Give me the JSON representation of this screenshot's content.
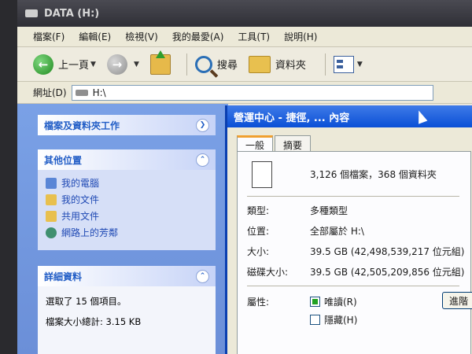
{
  "window": {
    "title": "DATA (H:)"
  },
  "menu": [
    "檔案(F)",
    "編輯(E)",
    "檢視(V)",
    "我的最愛(A)",
    "工具(T)",
    "說明(H)"
  ],
  "toolbar": {
    "back": "上一頁",
    "search": "搜尋",
    "folders": "資料夾"
  },
  "address": {
    "label": "網址(D)",
    "value": "H:\\"
  },
  "tasks": {
    "file_folder_tasks": "檔案及資料夾工作",
    "other_places": {
      "title": "其他位置",
      "items": [
        "我的電腦",
        "我的文件",
        "共用文件",
        "網路上的芳鄰"
      ]
    },
    "details": {
      "title": "詳細資料",
      "selected": "選取了 15 個項目。",
      "total_size": "檔案大小總計: 3.15 KB"
    }
  },
  "dialog": {
    "title": "營運中心 - 捷徑, ... 內容",
    "tabs": [
      "一般",
      "摘要"
    ],
    "summary": "3,126 個檔案，368 個資料夾",
    "rows": {
      "type_label": "類型:",
      "type_value": "多種類型",
      "location_label": "位置:",
      "location_value": "全部屬於 H:\\",
      "size_label": "大小:",
      "size_value": "39.5 GB (42,498,539,217 位元組)",
      "disk_label": "磁碟大小:",
      "disk_value": "39.5 GB (42,505,209,856 位元組)",
      "attr_label": "屬性:",
      "readonly": "唯讀(R)",
      "hidden": "隱藏(H)"
    },
    "advanced": "進階"
  }
}
